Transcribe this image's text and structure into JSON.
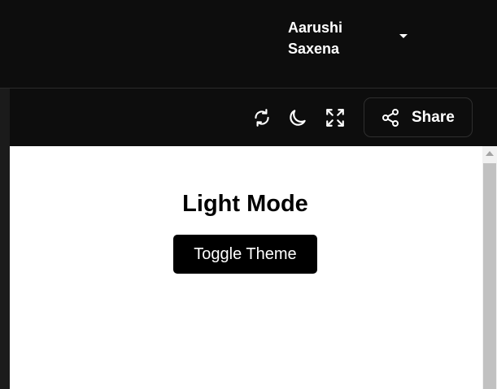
{
  "header": {
    "user_name": "Aarushi Saxena",
    "user_menu_icon": "caret-down-icon"
  },
  "toolbar": {
    "icons": [
      "refresh-icon",
      "moon-icon",
      "fullscreen-icon"
    ],
    "share_label": "Share",
    "share_icon": "share-icon"
  },
  "preview": {
    "heading": "Light Mode",
    "toggle_label": "Toggle Theme",
    "background": "#ffffff",
    "button_color": "#000000"
  },
  "colors": {
    "app_background": "#0d0d0d",
    "text": "#ffffff"
  }
}
